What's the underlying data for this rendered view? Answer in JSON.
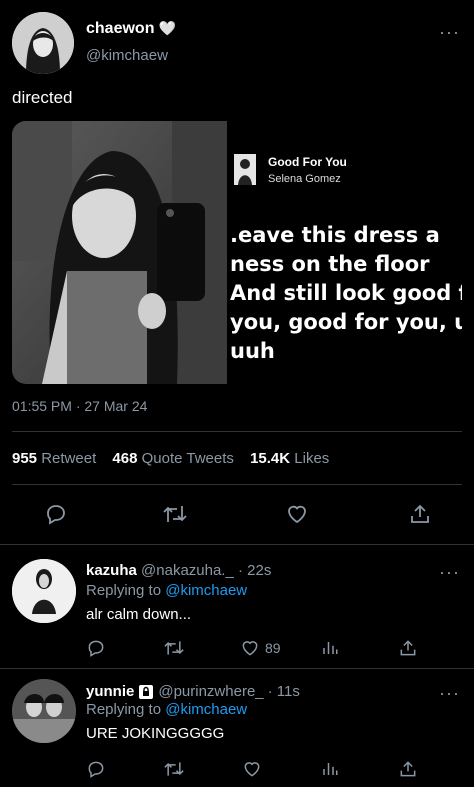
{
  "tweet": {
    "author_name": "chaewon",
    "author_emoji": "🤍",
    "author_handle": "@kimchaew",
    "text": "directed",
    "timestamp": "01:55 PM · 27 Mar 24",
    "media": {
      "song_title": "Good For You",
      "song_artist": "Selena Gomez",
      "lyrics": ".eave this dress a\nness on the floor\nAnd still look good for\nyou, good for you, uh-\nuuh"
    },
    "stats": {
      "retweets": "955",
      "retweets_label": "Retweet",
      "quotes": "468",
      "quotes_label": "Quote Tweets",
      "likes": "15.4K",
      "likes_label": "Likes"
    }
  },
  "replies": [
    {
      "name": "kazuha",
      "handle": "@nakazuha._",
      "time": "· 22s",
      "replying_prefix": "Replying to",
      "replying_to": "@kimchaew",
      "text": "alr calm down...",
      "likes": "89"
    },
    {
      "name": "yunnie",
      "handle": "@purinzwhere_",
      "time": "· 11s",
      "replying_prefix": "Replying to",
      "replying_to": "@kimchaew",
      "text": "URE JOKINGGGGG"
    }
  ],
  "colors": {
    "accent": "#1d9bf0",
    "secondary_text": "#8b98a5",
    "divider": "#2f3336"
  },
  "icons": [
    "more-icon",
    "heart-emoji",
    "lock-icon",
    "reply-icon",
    "retweet-icon",
    "like-icon",
    "share-icon",
    "analytics-icon"
  ]
}
